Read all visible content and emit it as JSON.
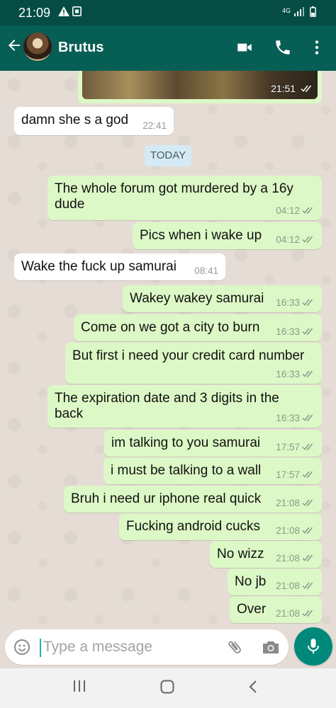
{
  "statusbar": {
    "time": "21:09",
    "network": "4G"
  },
  "header": {
    "contact_name": "Brutus"
  },
  "image_message": {
    "time": "21:51"
  },
  "day_divider": "TODAY",
  "messages": [
    {
      "dir": "in",
      "lines": [
        "damn she s a god"
      ],
      "time": "22:41"
    },
    {
      "dir": "out",
      "lines": [
        "The whole forum got murdered by a 16y",
        "dude"
      ],
      "time": "04:12"
    },
    {
      "dir": "out",
      "lines": [
        "Pics when i wake up"
      ],
      "time": "04:12"
    },
    {
      "dir": "in",
      "lines": [
        "Wake the fuck up samurai"
      ],
      "time": "08:41"
    },
    {
      "dir": "out",
      "lines": [
        "Wakey wakey samurai"
      ],
      "time": "16:33"
    },
    {
      "dir": "out",
      "lines": [
        "Come on we got a city to burn"
      ],
      "time": "16:33"
    },
    {
      "dir": "out",
      "lines": [
        "But first i need your credit card number"
      ],
      "time": "16:33"
    },
    {
      "dir": "out",
      "lines": [
        "The expiration date and 3 digits in the",
        "back"
      ],
      "time": "16:33"
    },
    {
      "dir": "out",
      "lines": [
        "im talking to you samurai"
      ],
      "time": "17:57"
    },
    {
      "dir": "out",
      "lines": [
        "i must be talking to a wall"
      ],
      "time": "17:57"
    },
    {
      "dir": "out",
      "lines": [
        "Bruh i need ur iphone real quick"
      ],
      "time": "21:08"
    },
    {
      "dir": "out",
      "lines": [
        "Fucking android cucks"
      ],
      "time": "21:08"
    },
    {
      "dir": "out",
      "lines": [
        "No wizz"
      ],
      "time": "21:08"
    },
    {
      "dir": "out",
      "lines": [
        "No jb"
      ],
      "time": "21:08"
    },
    {
      "dir": "out",
      "lines": [
        "Over"
      ],
      "time": "21:08"
    }
  ],
  "composer": {
    "placeholder": "Type a message"
  },
  "colors": {
    "header": "#075e54",
    "outgoing": "#dcf8c6",
    "incoming": "#ffffff",
    "accent": "#00897b"
  },
  "icons": [
    "back-arrow-icon",
    "video-call-icon",
    "phone-icon",
    "more-vert-icon",
    "emoji-icon",
    "attach-icon",
    "camera-icon",
    "mic-icon"
  ]
}
